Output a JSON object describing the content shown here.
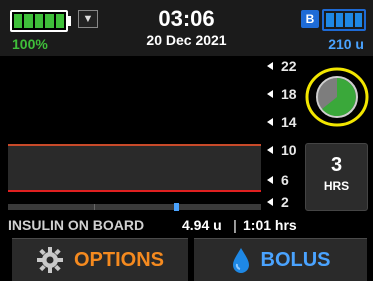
{
  "status": {
    "battery_percent": "100%",
    "battery_level": 1.0,
    "time": "03:06",
    "date": "20 Dec 2021",
    "bluetooth_badge": "B",
    "cartridge_units": "210 u",
    "cartridge_level": 1.0,
    "signal_icon": "signal-icon"
  },
  "graph": {
    "y_labels": [
      "22",
      "18",
      "14",
      "10",
      "6",
      "2"
    ]
  },
  "dial": {
    "icon": "bolus-dial-icon",
    "fill_color": "#3aa83a",
    "ring_color": "#f2e600"
  },
  "hours_button": {
    "value": "3",
    "label": "HRS"
  },
  "iob": {
    "label": "INSULIN ON BOARD",
    "value": "4.94 u",
    "separator": "|",
    "time": "1:01 hrs"
  },
  "buttons": {
    "options_label": "OPTIONS",
    "options_icon": "gear-icon",
    "bolus_label": "BOLUS",
    "bolus_icon": "drop-icon"
  },
  "colors": {
    "green": "#3fbf3a",
    "blue": "#1e88e5",
    "orange": "#f58a1f"
  }
}
